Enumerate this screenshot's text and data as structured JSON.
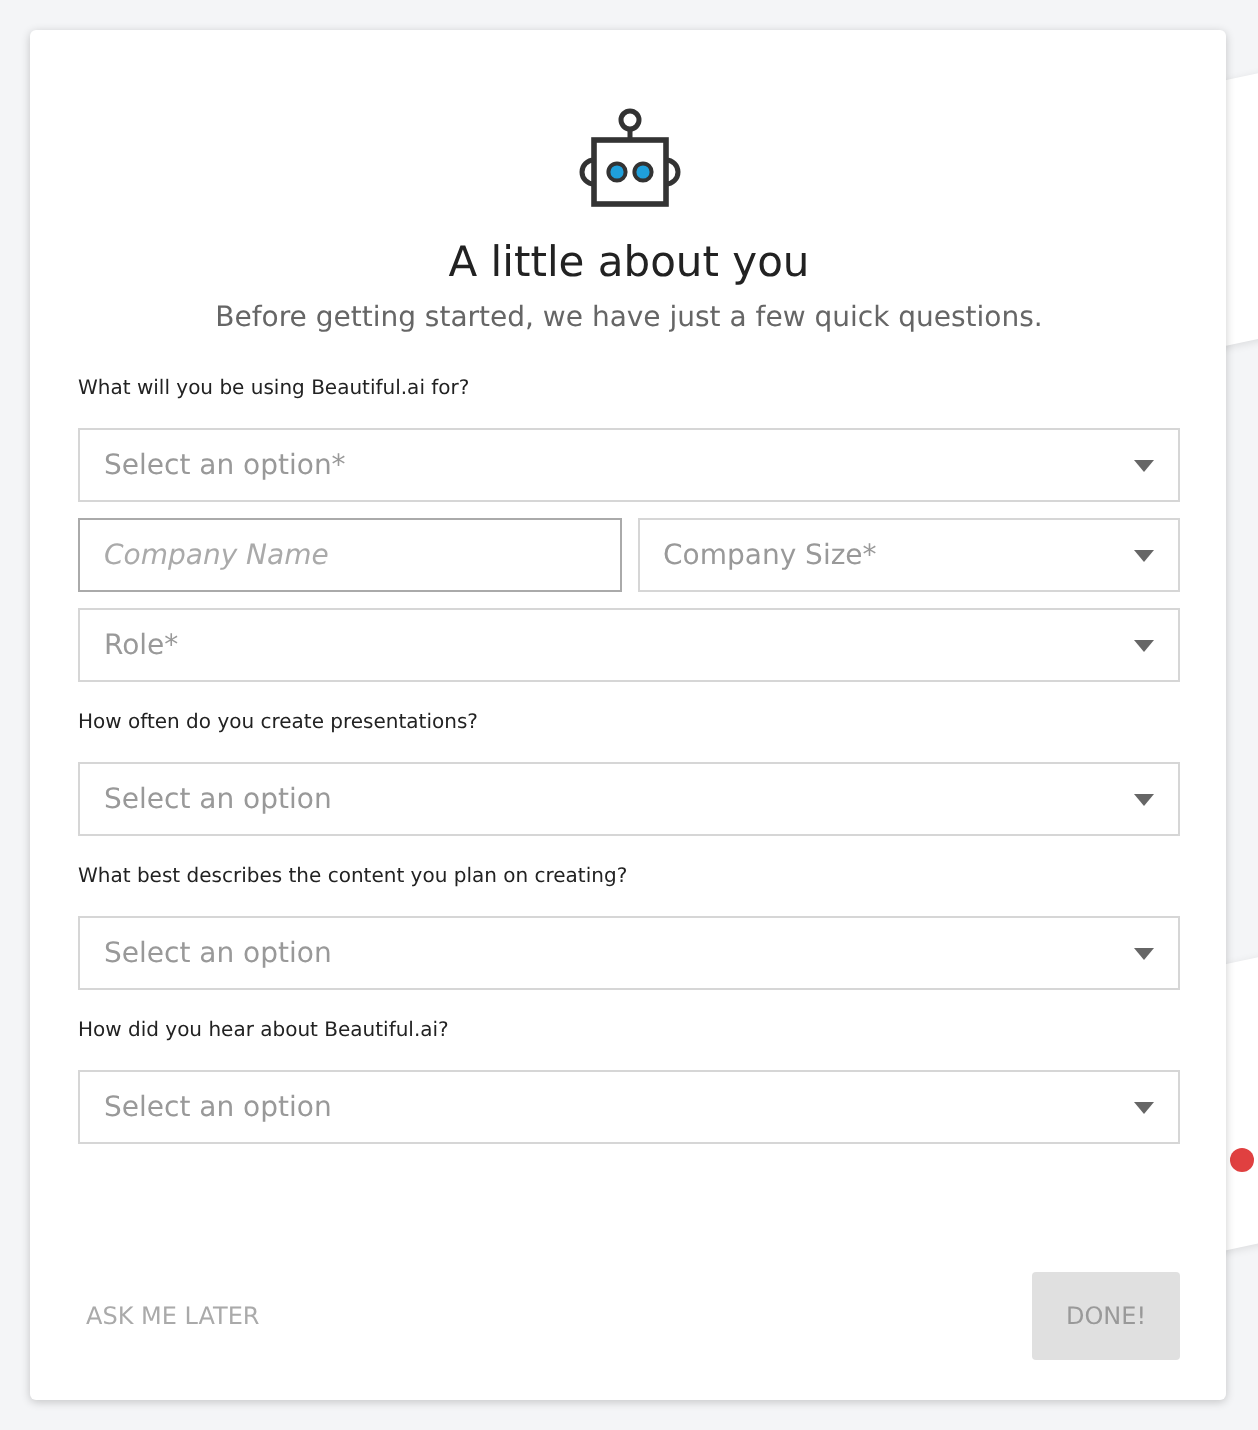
{
  "dialog": {
    "title": "A little about you",
    "subtitle": "Before getting started, we have just a few quick questions."
  },
  "questions": [
    {
      "label": "What will you be using Beautiful.ai for?",
      "rows": [
        [
          {
            "kind": "select",
            "placeholder": "Select an option*"
          }
        ],
        [
          {
            "kind": "input",
            "placeholder": "Company Name"
          },
          {
            "kind": "select",
            "placeholder": "Company Size*"
          }
        ],
        [
          {
            "kind": "select",
            "placeholder": "Role*"
          }
        ]
      ]
    },
    {
      "label": "How often do you create presentations?",
      "rows": [
        [
          {
            "kind": "select",
            "placeholder": "Select an option"
          }
        ]
      ]
    },
    {
      "label": "What best describes the content you plan on creating?",
      "rows": [
        [
          {
            "kind": "select",
            "placeholder": "Select an option"
          }
        ]
      ]
    },
    {
      "label": "How did you hear about Beautiful.ai?",
      "rows": [
        [
          {
            "kind": "select",
            "placeholder": "Select an option"
          }
        ]
      ]
    }
  ],
  "footer": {
    "later": "ASK ME LATER",
    "done": {
      "label": "DONE!",
      "disabled": true
    }
  }
}
